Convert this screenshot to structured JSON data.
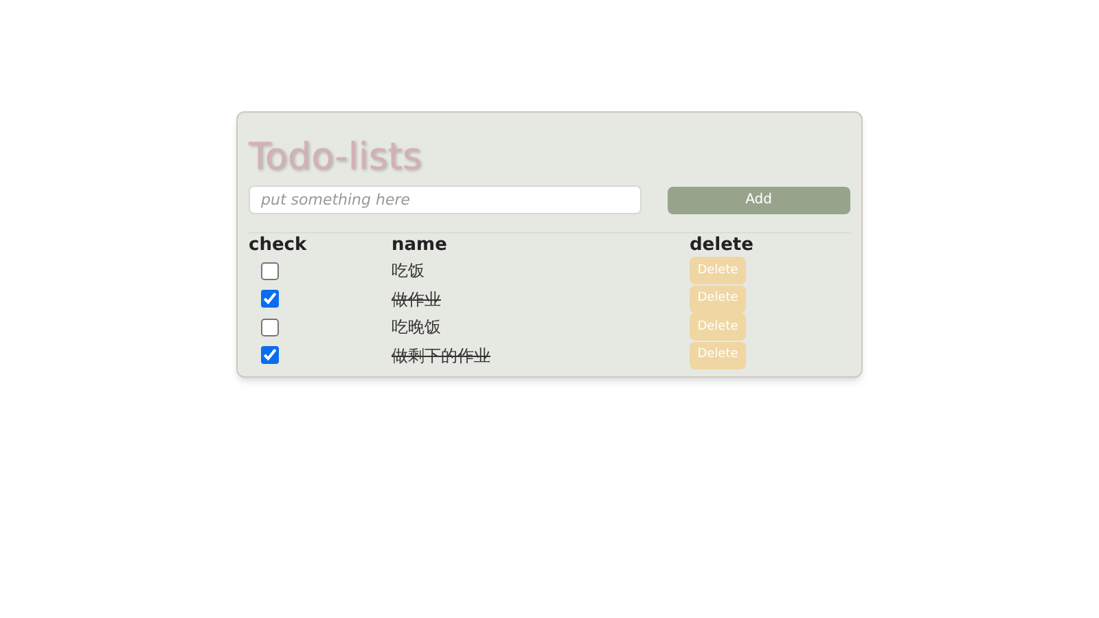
{
  "title": "Todo-lists",
  "input": {
    "placeholder": "put something here"
  },
  "add_button": "Add",
  "columns": [
    "check",
    "name",
    "delete"
  ],
  "rows": [
    {
      "name": "吃饭",
      "checked": false,
      "delete": "Delete"
    },
    {
      "name": "做作业",
      "checked": true,
      "delete": "Delete"
    },
    {
      "name": "吃晚饭",
      "checked": false,
      "delete": "Delete"
    },
    {
      "name": "做剩下的作业",
      "checked": true,
      "delete": "Delete"
    }
  ]
}
